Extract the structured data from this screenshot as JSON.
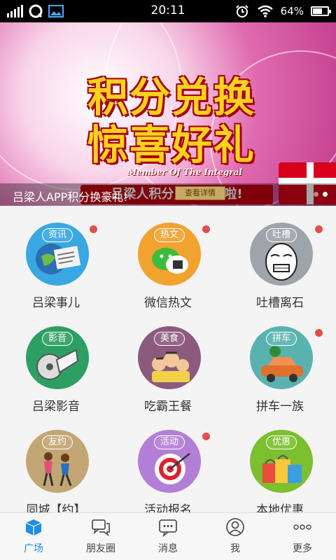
{
  "status_bar": {
    "time": "20:11",
    "battery": "64%",
    "battery_level": 0.64
  },
  "banner": {
    "headline_line1": "积分兑换",
    "headline_line2": "惊喜好礼",
    "subtitle": "Member Of The Integral",
    "slogan": "吕梁人积分兑换开始啦!",
    "caption": "吕梁人APP积分换豪礼!",
    "detail_button": "查看详情",
    "slide_count": 2,
    "active_slide": 1
  },
  "grid": {
    "items": [
      {
        "tag": "资讯",
        "label": "吕梁事儿",
        "color": "#39a7e3",
        "icon": "newspaper-globe-icon",
        "badge": true
      },
      {
        "tag": "热文",
        "label": "微信热文",
        "color": "#f1a22f",
        "icon": "wechat-icon",
        "badge": true
      },
      {
        "tag": "吐槽",
        "label": "吐槽离石",
        "color": "#9ea4ab",
        "icon": "meme-face-icon",
        "badge": true
      },
      {
        "tag": "影音",
        "label": "吕梁影音",
        "color": "#2e9f63",
        "icon": "film-reel-icon",
        "badge": false
      },
      {
        "tag": "美食",
        "label": "吃霸王餐",
        "color": "#8c5a7d",
        "icon": "diners-icon",
        "badge": false
      },
      {
        "tag": "拼车",
        "label": "拼车一族",
        "color": "#5ab2b0",
        "icon": "car-icon",
        "badge": true
      },
      {
        "tag": "友约",
        "label": "同城【约】",
        "color": "#c4a574",
        "icon": "dancers-icon",
        "badge": false
      },
      {
        "tag": "活动",
        "label": "活动报名",
        "color": "#b37fd6",
        "icon": "target-icon",
        "badge": true
      },
      {
        "tag": "优惠",
        "label": "本地优惠",
        "color": "#7cbf2f",
        "icon": "shopping-bags-icon",
        "badge": false
      }
    ]
  },
  "tabs": [
    {
      "label": "广场",
      "icon": "cube-icon",
      "active": true
    },
    {
      "label": "朋友圈",
      "icon": "chat-bubbles-icon",
      "active": false
    },
    {
      "label": "消息",
      "icon": "message-icon",
      "active": false
    },
    {
      "label": "我",
      "icon": "person-icon",
      "active": false
    },
    {
      "label": "更多",
      "icon": "more-dots-icon",
      "active": false
    }
  ],
  "colors": {
    "accent": "#1e8ee0",
    "badge": "#e64c4c",
    "status_bar": "#000000"
  }
}
